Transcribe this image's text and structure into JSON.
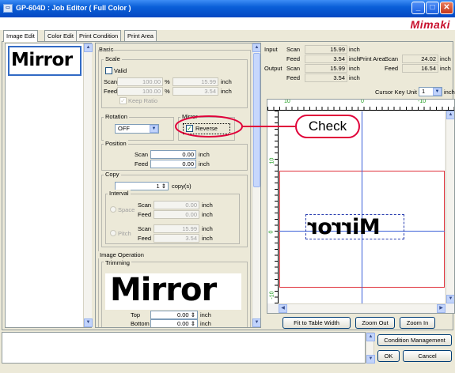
{
  "window": {
    "title": "GP-604D : Job Editor ( Full Color )",
    "brand": "Mimaki",
    "minimize": "_",
    "maximize": "□",
    "close": "✕"
  },
  "tabs": [
    "Image Edit",
    "Color Edit",
    "Print Condition",
    "Print Area"
  ],
  "thumbnail": {
    "text": "Mirror"
  },
  "basic": {
    "title": "Basic",
    "scale": {
      "title": "Scale",
      "valid_label": "Valid",
      "scan_label": "Scan",
      "feed_label": "Feed",
      "scan_pct": "100.00",
      "feed_pct": "100.00",
      "pct_unit": "%",
      "scan_inch": "15.99",
      "feed_inch": "3.54",
      "inch_unit": "inch",
      "keep_ratio": "Keep Ratio"
    },
    "rotation": {
      "title": "Rotation",
      "value": "OFF"
    },
    "mirror": {
      "title": "Mirror",
      "reverse_label": "Reverse",
      "reverse_checked": true
    },
    "position": {
      "title": "Position",
      "scan_label": "Scan",
      "feed_label": "Feed",
      "scan": "0.00",
      "feed": "0.00",
      "unit": "inch"
    },
    "copy": {
      "title": "Copy",
      "count": "1",
      "unit": "copy(s)",
      "interval_title": "Interval",
      "space_label": "Space",
      "pitch_label": "Pitch",
      "scan_label": "Scan",
      "feed_label": "Feed",
      "space_scan": "0.00",
      "space_feed": "0.00",
      "pitch_scan": "15.99",
      "pitch_feed": "3.54",
      "inch": "inch"
    },
    "image_operation": {
      "title": "Image Operation",
      "trimming": "Trimming",
      "preview_text": "Mirror",
      "top_label": "Top",
      "bottom_label": "Bottom",
      "top": "0.00",
      "bottom": "0.00",
      "unit": "inch"
    }
  },
  "info": {
    "input_label": "Input",
    "output_label": "Output",
    "scan_label": "Scan",
    "feed_label": "Feed",
    "input_scan": "15.99",
    "input_feed": "3.54",
    "output_scan": "15.99",
    "output_feed": "3.54",
    "unit": "inch",
    "print_area_label": "Print Area",
    "pa_scan": "24.02",
    "pa_feed": "16.54",
    "cursor_key_unit_label": "Cursor Key Unit",
    "cursor_key_unit_value": "1",
    "cursor_unit": "inch"
  },
  "ruler": {
    "h_labels": [
      "10",
      "0",
      "-10"
    ],
    "v_labels": [
      "10",
      "0",
      "-10"
    ]
  },
  "preview": {
    "mirror_text": "Mirror"
  },
  "buttons": {
    "fit": "Fit to Table Width",
    "zoom_out": "Zoom Out",
    "zoom_in": "Zoom In",
    "condition": "Condition Management",
    "ok": "OK",
    "cancel": "Cancel"
  },
  "callout": {
    "text": "Check"
  },
  "scroll_glyphs": {
    "up": "▲",
    "down": "▼",
    "left": "◀",
    "right": "▶",
    "dropdown": "▼",
    "spin": "⇕"
  }
}
